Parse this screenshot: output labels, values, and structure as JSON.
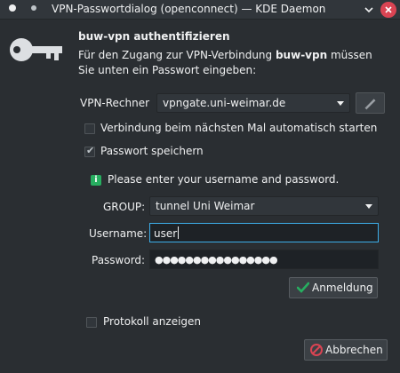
{
  "window": {
    "title": "VPN-Passwortdialog (openconnect) — KDE Daemon"
  },
  "dialog": {
    "heading": "buw-vpn authentifizieren",
    "description_pre": "Für den Zugang zur VPN-Verbindung ",
    "description_bold": "buw-vpn",
    "description_post": " müssen Sie unten ein Passwort eingeben:"
  },
  "vpn_host": {
    "label": "VPN-Rechner",
    "value": "vpngate.uni-weimar.de"
  },
  "autostart": {
    "label": "Verbindung beim nächsten Mal automatisch starten",
    "checked": false
  },
  "save_password": {
    "label": "Passwort speichern",
    "checked": true
  },
  "info": {
    "text": "Please enter your username and password."
  },
  "group": {
    "label": "GROUP:",
    "value": "tunnel Uni Weimar"
  },
  "username": {
    "label": "Username:",
    "value": "user"
  },
  "password": {
    "label": "Password:",
    "value": "●●●●●●●●●●●●●●●●"
  },
  "login_button": {
    "label": "Anmeldung"
  },
  "show_log": {
    "label": "Protokoll anzeigen",
    "checked": false
  },
  "cancel_button": {
    "label": "Abbrechen"
  },
  "colors": {
    "background": "#2a2e32",
    "focus": "#3daee9",
    "ok_green": "#27ae60",
    "cancel_red": "#da4453"
  }
}
